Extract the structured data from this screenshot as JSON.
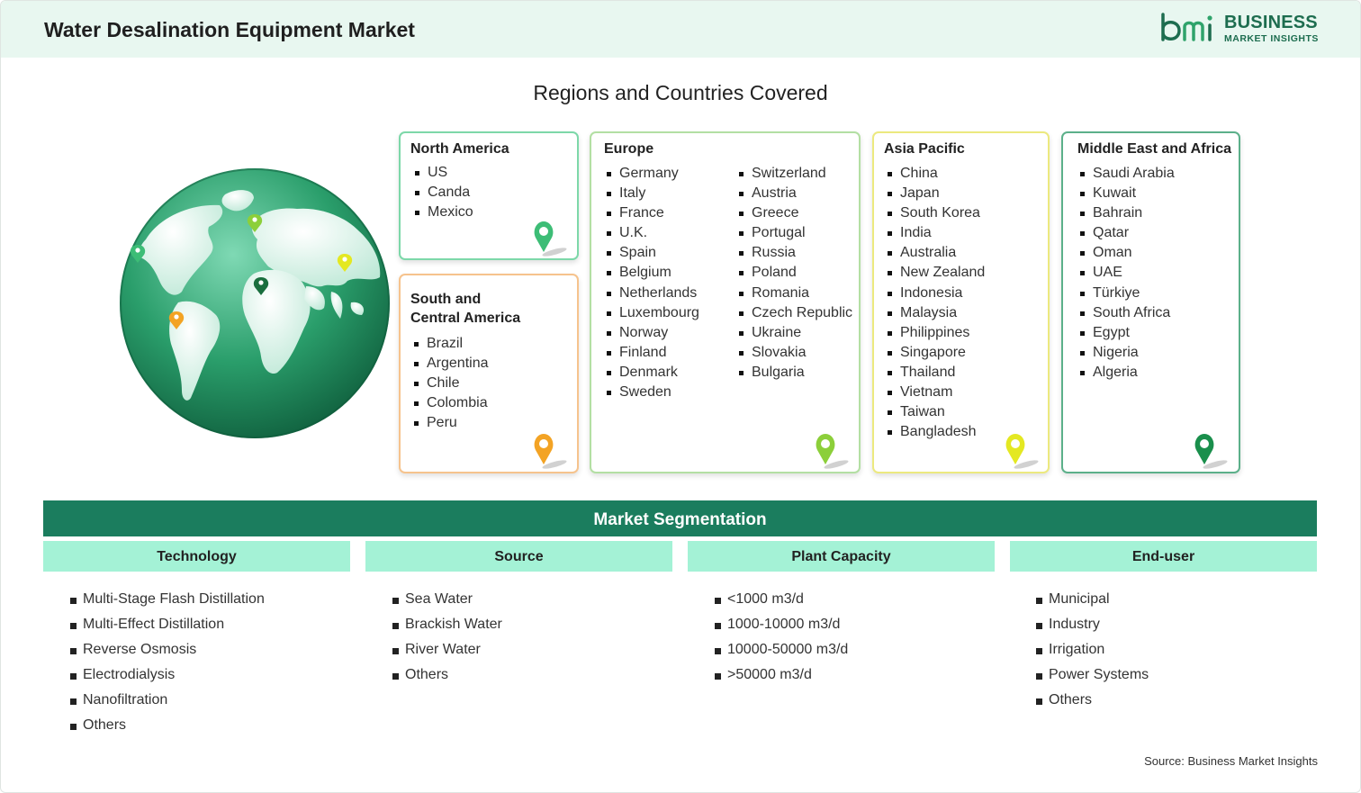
{
  "header": {
    "title": "Water Desalination Equipment Market",
    "logo_line1": "BUSINESS",
    "logo_line2": "MARKET INSIGHTS"
  },
  "regions_title": "Regions and Countries Covered",
  "regions": {
    "north_america": {
      "title": "North America",
      "countries": [
        "US",
        "Canda",
        "Mexico"
      ],
      "color": "#7dd8a9"
    },
    "south_central_america": {
      "title_line1": "South and",
      "title_line2": "Central America",
      "countries": [
        "Brazil",
        "Argentina",
        "Chile",
        "Colombia",
        "Peru"
      ],
      "color": "#f6c38d"
    },
    "europe": {
      "title": "Europe",
      "countries_col1": [
        "Germany",
        "Italy",
        "France",
        "U.K.",
        "Spain",
        "Belgium",
        "Netherlands",
        "Luxembourg",
        "Norway",
        "Finland",
        "Denmark",
        "Sweden"
      ],
      "countries_col2": [
        "Switzerland",
        "Austria",
        "Greece",
        "Portugal",
        "Russia",
        "Poland",
        "Romania",
        "Czech Republic",
        "Ukraine",
        "Slovakia",
        "Bulgaria"
      ],
      "color": "#b3dfa3"
    },
    "asia_pacific": {
      "title": "Asia Pacific",
      "countries": [
        "China",
        "Japan",
        "South Korea",
        "India",
        "Australia",
        "New Zealand",
        "Indonesia",
        "Malaysia",
        "Philippines",
        "Singapore",
        "Thailand",
        "Vietnam",
        "Taiwan",
        "Bangladesh"
      ],
      "color": "#ece97f"
    },
    "middle_east_africa": {
      "title": "Middle East and Africa",
      "countries": [
        "Saudi Arabia",
        "Kuwait",
        "Bahrain",
        "Qatar",
        "Oman",
        "UAE",
        "Türkiye",
        "South Africa",
        "Egypt",
        "Nigeria",
        "Algeria"
      ],
      "color": "#5cb08a"
    }
  },
  "segmentation": {
    "title": "Market Segmentation",
    "columns": [
      {
        "header": "Technology",
        "items": [
          "Multi-Stage Flash Distillation",
          "Multi-Effect Distillation",
          "Reverse Osmosis",
          "Electrodialysis",
          "Nanofiltration",
          "Others"
        ]
      },
      {
        "header": "Source",
        "items": [
          "Sea Water",
          "Brackish Water",
          "River Water",
          "Others"
        ]
      },
      {
        "header": "Plant Capacity",
        "items": [
          "<1000 m3/d",
          "1000-10000 m3/d",
          "10000-50000 m3/d",
          ">50000 m3/d"
        ]
      },
      {
        "header": "End-user",
        "items": [
          "Municipal",
          "Industry",
          "Irrigation",
          "Power Systems",
          "Others"
        ]
      }
    ]
  },
  "source": "Source: Business Market Insights",
  "colors": {
    "header_bg": "#e8f7f0",
    "brand_green": "#1d6d4f",
    "segment_bar": "#1b7d5e",
    "segment_header": "#a4f2d6",
    "pin_na": "#3dbd76",
    "pin_sa": "#f3a324",
    "pin_eu": "#8ccf3a",
    "pin_ap": "#e4e822",
    "pin_mea": "#1a8f4c"
  },
  "icons": [
    "globe-icon",
    "location-pin-icon",
    "bmi-logo-icon"
  ]
}
